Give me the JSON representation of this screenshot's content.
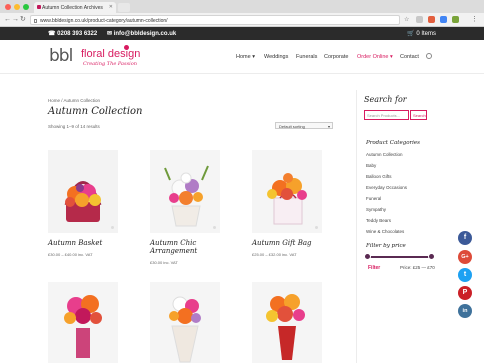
{
  "browser": {
    "tab_title": "Autumn Collection Archives",
    "url": "www.bbldesign.co.uk/product-category/autumn-collection/"
  },
  "topbar": {
    "phone": "0208 393 6322",
    "email": "info@bbldesign.co.uk",
    "cart": "0 Items"
  },
  "logo": {
    "bbl": "bbl",
    "name": "floral design",
    "tagline": "Creating The Passion"
  },
  "nav": [
    {
      "label": "Home",
      "dropdown": true
    },
    {
      "label": "Weddings",
      "dropdown": false
    },
    {
      "label": "Funerals",
      "dropdown": false
    },
    {
      "label": "Corporate",
      "dropdown": false
    },
    {
      "label": "Order Online",
      "dropdown": true
    },
    {
      "label": "Contact",
      "dropdown": false
    }
  ],
  "breadcrumb": "Home / Autumn Collection",
  "page_title": "Autumn Collection",
  "results": "Showing 1–9 of 14 results",
  "sort": "Default sorting",
  "products": [
    {
      "name": "Autumn Basket",
      "price": "£30.00 – £40.00 inc. VAT"
    },
    {
      "name": "Autumn Chic Arrangement",
      "price": "£30.00 inc. VAT"
    },
    {
      "name": "Autumn Gift Bag",
      "price": "£25.00 – £32.00 inc. VAT"
    }
  ],
  "sidebar": {
    "search_title": "Search for",
    "search_placeholder": "Search Products...",
    "search_button": "Search",
    "categories_title": "Product Categories",
    "categories": [
      "Autumn Collection",
      "Baby",
      "Balloon Gifts",
      "Everyday Occasions",
      "Funeral",
      "Sympathy",
      "Teddy Bears",
      "Wine & Chocolates"
    ],
    "filter_title": "Filter by price",
    "filter_button": "Filter",
    "price_range": "Price: £25 — £70"
  },
  "social": [
    "f",
    "G+",
    "t",
    "P",
    "in"
  ],
  "colors": {
    "brand_pink": "#d81b60",
    "slider": "#5a2a52",
    "facebook": "#3b5998",
    "google": "#dd4b39",
    "twitter": "#1da1f2",
    "pinterest": "#cb2027",
    "instagram": "#3f729b"
  }
}
